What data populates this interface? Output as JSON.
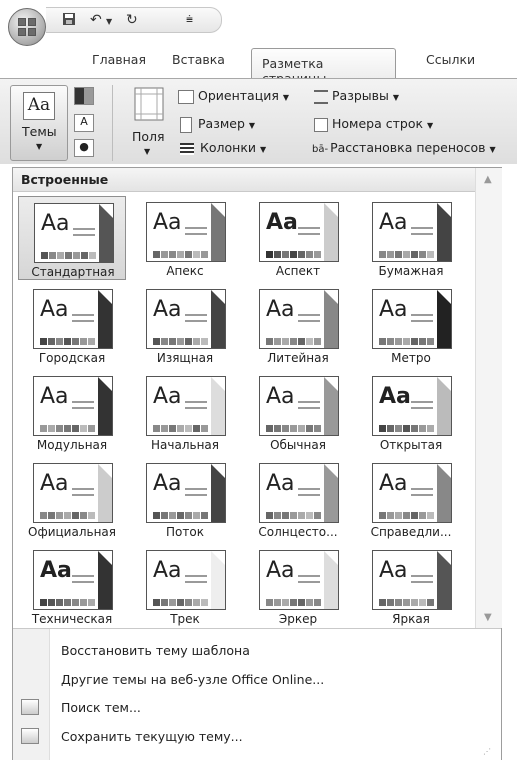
{
  "qat": {
    "dropdown_glyph": "▼"
  },
  "tabs": [
    {
      "label": "Главная"
    },
    {
      "label": "Вставка"
    },
    {
      "label": "Разметка страницы"
    },
    {
      "label": "Ссылки"
    }
  ],
  "ribbon": {
    "themes_label": "Темы",
    "themes_icon_text": "Aa",
    "fields_label": "Поля",
    "orientation_label": "Ориентация",
    "size_label": "Размер",
    "columns_label": "Колонки",
    "breaks_label": "Разрывы",
    "line_numbers_label": "Номера строк",
    "hyphenation_label": "Расстановка переносов",
    "hyphen_icon_text": "bā-",
    "font_icon_text": "A"
  },
  "gallery": {
    "header": "Встроенные",
    "sample_text": "Aa",
    "themes": [
      {
        "name": "Стандартная"
      },
      {
        "name": "Апекс"
      },
      {
        "name": "Аспект"
      },
      {
        "name": "Бумажная"
      },
      {
        "name": "Городская"
      },
      {
        "name": "Изящная"
      },
      {
        "name": "Литейная"
      },
      {
        "name": "Метро"
      },
      {
        "name": "Модульная"
      },
      {
        "name": "Начальная"
      },
      {
        "name": "Обычная"
      },
      {
        "name": "Открытая"
      },
      {
        "name": "Официальная"
      },
      {
        "name": "Поток"
      },
      {
        "name": "Солнцесто..."
      },
      {
        "name": "Справедли..."
      },
      {
        "name": "Техническая"
      },
      {
        "name": "Трек"
      },
      {
        "name": "Эркер"
      },
      {
        "name": "Яркая"
      }
    ]
  },
  "menu": {
    "restore": "Восстановить тему шаблона",
    "more_online": "Другие темы на веб-узле Office Online...",
    "search": "Поиск тем...",
    "save_current": "Сохранить текущую тему..."
  }
}
